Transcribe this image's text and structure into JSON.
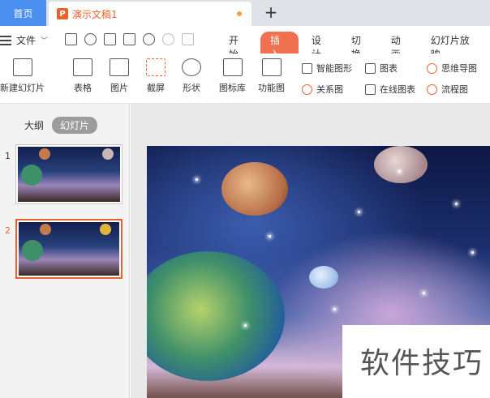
{
  "titlebar": {
    "home_tab": "首页",
    "doc_tab_title": "演示文稿1",
    "doc_icon_letter": "P",
    "add_tab": "+"
  },
  "menubar": {
    "file_label": "文件",
    "tabs": [
      "开始",
      "插入",
      "设计",
      "切换",
      "动画",
      "幻灯片放映"
    ],
    "active_tab": "插入"
  },
  "ribbon": {
    "new_slide": "新建幻灯片",
    "table": "表格",
    "picture": "图片",
    "screenshot": "截屏",
    "shape": "形状",
    "icon_library": "图标库",
    "function_chart": "功能图",
    "smart_graphic": "智能图形",
    "chart": "图表",
    "relation_chart": "关系图",
    "online_chart": "在线图表",
    "mind_map": "思维导图",
    "flowchart": "流程图"
  },
  "leftpanel": {
    "outline_tab": "大纲",
    "slides_tab": "幻灯片",
    "slides": [
      {
        "number": "1"
      },
      {
        "number": "2"
      }
    ]
  },
  "watermark": "软件技巧",
  "colors": {
    "accent": "#e8622f",
    "home_tab": "#4a8ef0",
    "active_tab_pill": "#f0714f"
  }
}
